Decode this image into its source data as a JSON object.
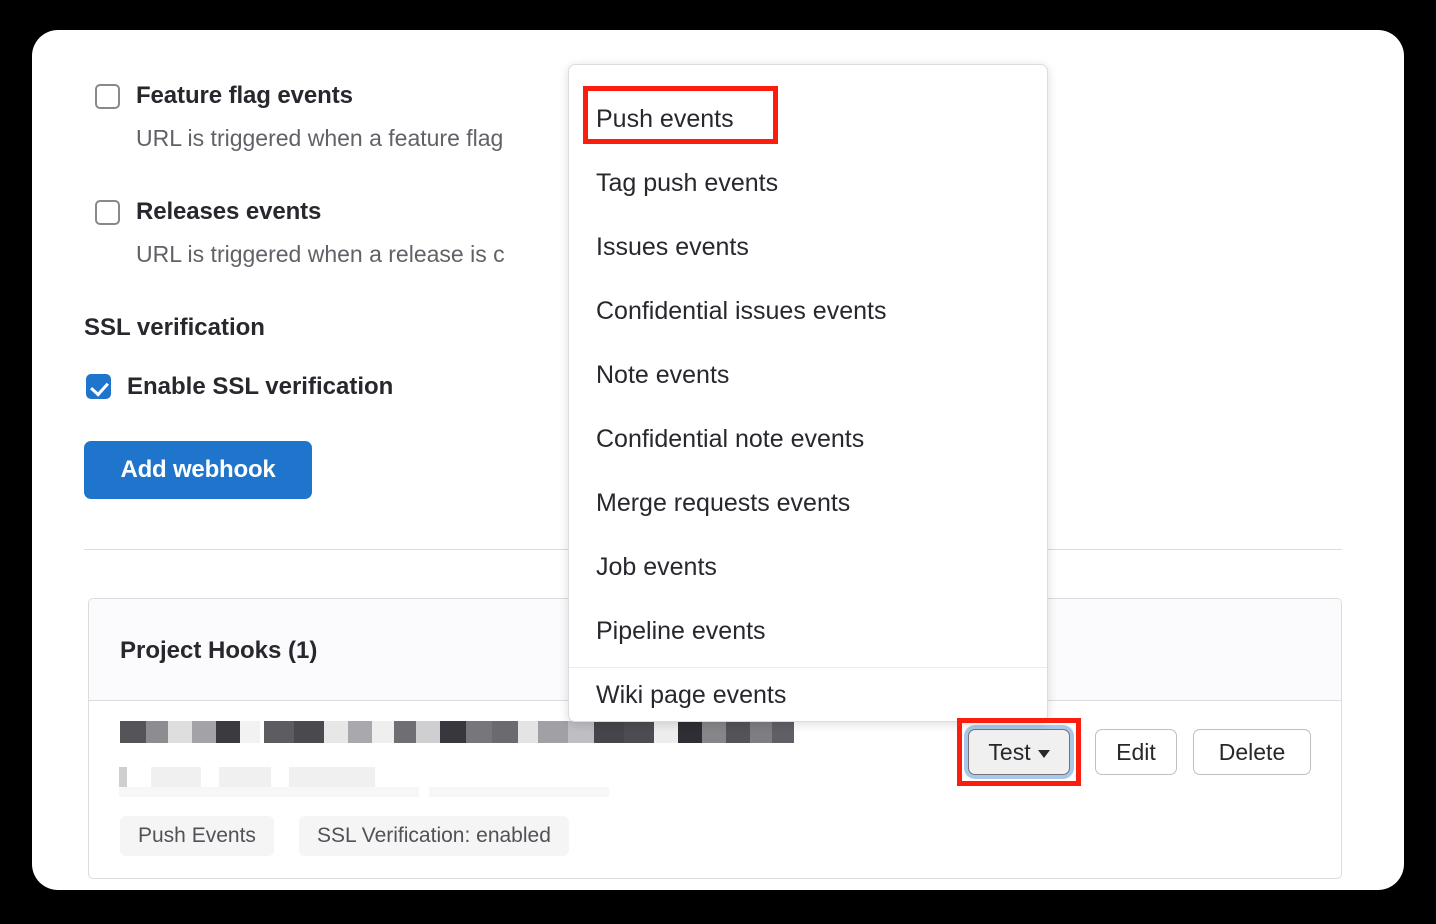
{
  "page": {
    "sections": {
      "events": [
        {
          "id": "feature-flag-events",
          "title": "Feature flag events",
          "description": "URL is triggered when a feature flag",
          "checked": false
        },
        {
          "id": "releases-events",
          "title": "Releases events",
          "description": "URL is triggered when a release is c",
          "checked": false
        }
      ],
      "ssl": {
        "heading": "SSL verification",
        "checkbox_label": "Enable SSL verification",
        "checked": true
      }
    },
    "primary_button": {
      "label": "Add webhook"
    }
  },
  "hooks_card": {
    "title": "Project Hooks (1)",
    "row": {
      "url_redacted": true,
      "badges": [
        {
          "id": "push-events",
          "label": "Push Events"
        },
        {
          "id": "ssl-verification",
          "label": "SSL Verification: enabled"
        }
      ],
      "actions": [
        {
          "id": "test",
          "label": "Test",
          "has_caret": true,
          "focused": true,
          "highlighted": true
        },
        {
          "id": "edit",
          "label": "Edit",
          "has_caret": false,
          "focused": false,
          "highlighted": false
        },
        {
          "id": "delete",
          "label": "Delete",
          "has_caret": false,
          "focused": false,
          "highlighted": false
        }
      ]
    }
  },
  "dropdown": {
    "open": true,
    "anchor": "test-button",
    "highlighted_item": "Push events",
    "items": [
      {
        "label": "Push events"
      },
      {
        "label": "Tag push events"
      },
      {
        "label": "Issues events"
      },
      {
        "label": "Confidential issues events"
      },
      {
        "label": "Note events"
      },
      {
        "label": "Confidential note events"
      },
      {
        "label": "Merge requests events"
      },
      {
        "label": "Job events"
      },
      {
        "label": "Pipeline events"
      },
      {
        "label": "Wiki page events"
      }
    ]
  },
  "annotations": [
    {
      "id": "push-events-highlight",
      "target": "Push events",
      "color": "#fc1d0e"
    },
    {
      "id": "test-button-highlight",
      "target": "Test",
      "color": "#fc1d0e"
    }
  ],
  "colors": {
    "accent_blue": "#1f75cb",
    "annotation_red": "#fc1d0e",
    "focus_ring": "#a9c7e8",
    "text_primary": "#28272d",
    "text_secondary": "#626168",
    "border": "#dcdcde",
    "header_bg": "#fbfafd",
    "badge_bg": "#f5f5f5"
  }
}
